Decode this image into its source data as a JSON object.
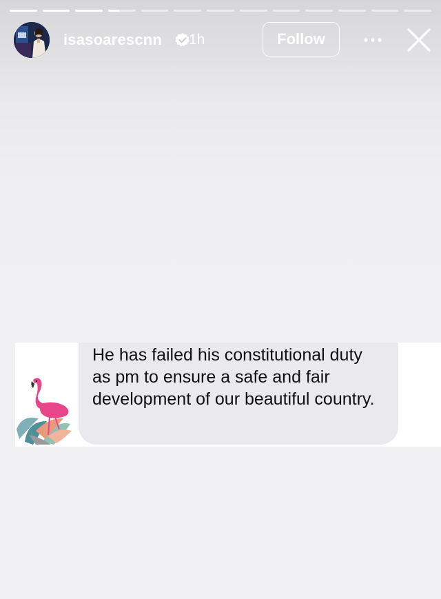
{
  "story": {
    "progress_segments": [
      1,
      1,
      1,
      0.4,
      0,
      0,
      0,
      0,
      0,
      0,
      0,
      0,
      0
    ],
    "username": "isasoarescnn",
    "verified": true,
    "timestamp": "1h",
    "follow_label": "Follow",
    "icons": {
      "more": "more-options-icon",
      "close": "close-icon",
      "verified": "verified-badge-icon"
    }
  },
  "content": {
    "message": "He has failed his constitutional duty as pm to ensure a safe and fair development of our beautiful country.",
    "sticker": "flamingo-sticker"
  },
  "colors": {
    "bubble": "#e9e9ee",
    "text": "#111111",
    "header_text": "#ffffff"
  }
}
